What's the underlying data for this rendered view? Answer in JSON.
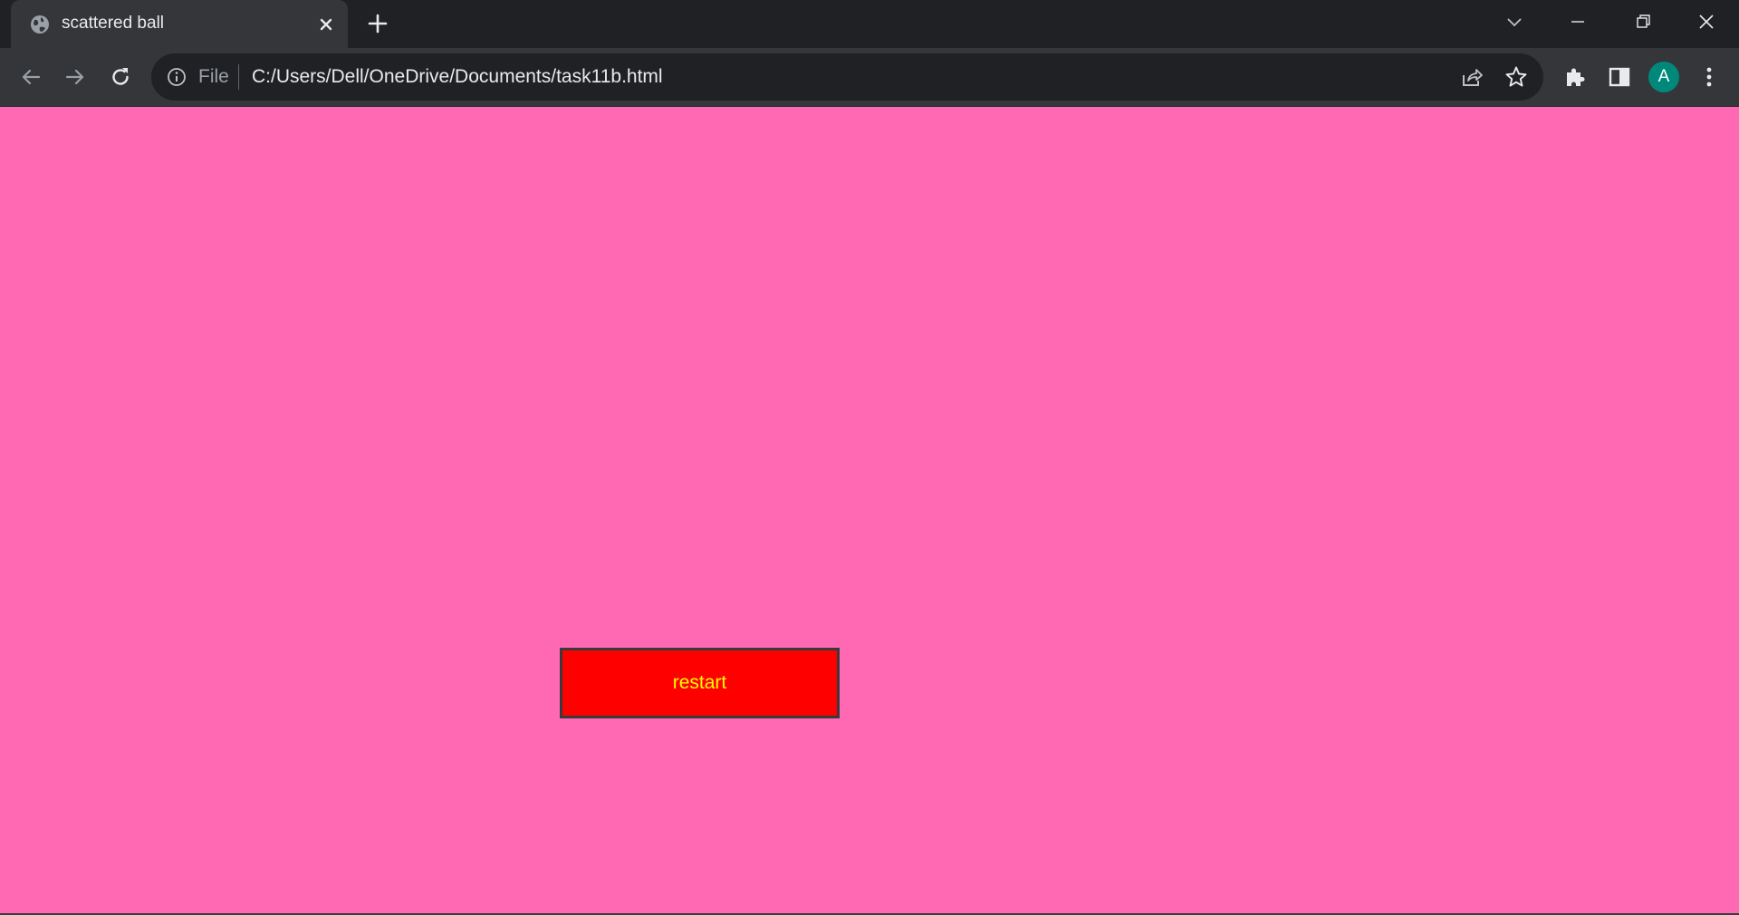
{
  "browser": {
    "tab": {
      "title": "scattered ball",
      "favicon": "globe-icon"
    },
    "omnibox": {
      "scheme_label": "File",
      "url": "C:/Users/Dell/OneDrive/Documents/task11b.html"
    },
    "profile_initial": "A",
    "colors": {
      "frame": "#202124",
      "toolbar": "#35363a",
      "avatar": "#00897b"
    }
  },
  "page": {
    "background_color": "#ff69b4",
    "restart_button": {
      "label": "restart",
      "background": "#ff0000",
      "text_color": "#ffff00"
    }
  }
}
